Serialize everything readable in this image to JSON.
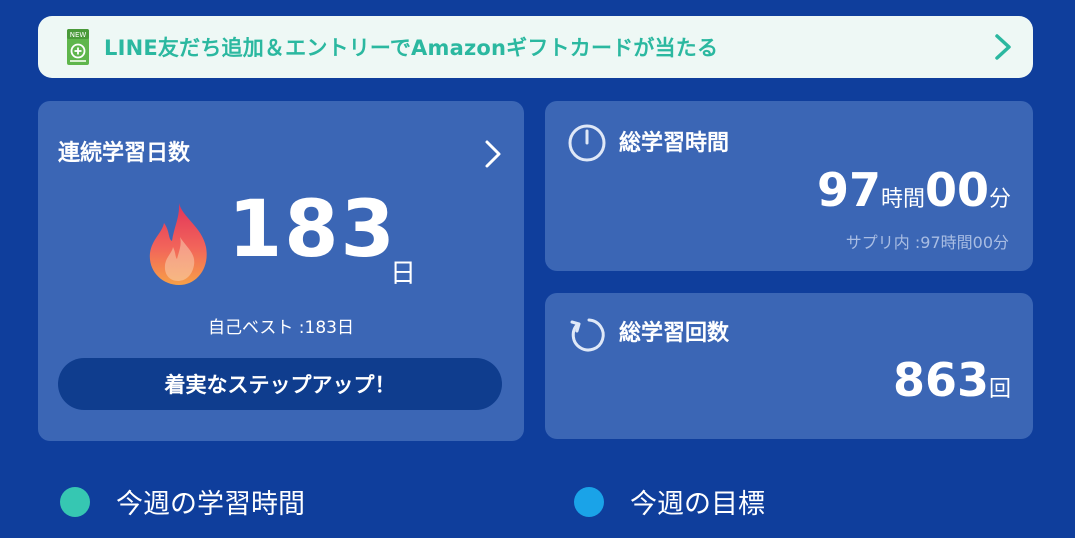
{
  "banner": {
    "text": "LINE友だち追加＆エントリーでAmazonギフトカードが当たる",
    "icon": "new-add-friend-icon",
    "icon_badge": "NEW"
  },
  "streak": {
    "title": "連続学習日数",
    "value": "183",
    "unit": "日",
    "best_label": "自己ベスト :183日",
    "message": "着実なステップアップ！",
    "icon": "flame-icon"
  },
  "total_time": {
    "title": "総学習時間",
    "hours": "97",
    "hours_unit": "時間",
    "minutes": "00",
    "minutes_unit": "分",
    "in_app_note": "サプリ内 :97時間00分",
    "icon": "clock-icon"
  },
  "total_count": {
    "title": "総学習回数",
    "value": "863",
    "unit": "回",
    "icon": "refresh-icon"
  },
  "legend": [
    {
      "label": "今週の学習時間",
      "color": "#36c7b2"
    },
    {
      "label": "今週の目標",
      "color": "#1aa3e8"
    }
  ],
  "colors": {
    "background": "#0f3e9c",
    "card": "#3b66b5",
    "pill": "#0f3d8e",
    "banner_text": "#2bb8a0"
  }
}
